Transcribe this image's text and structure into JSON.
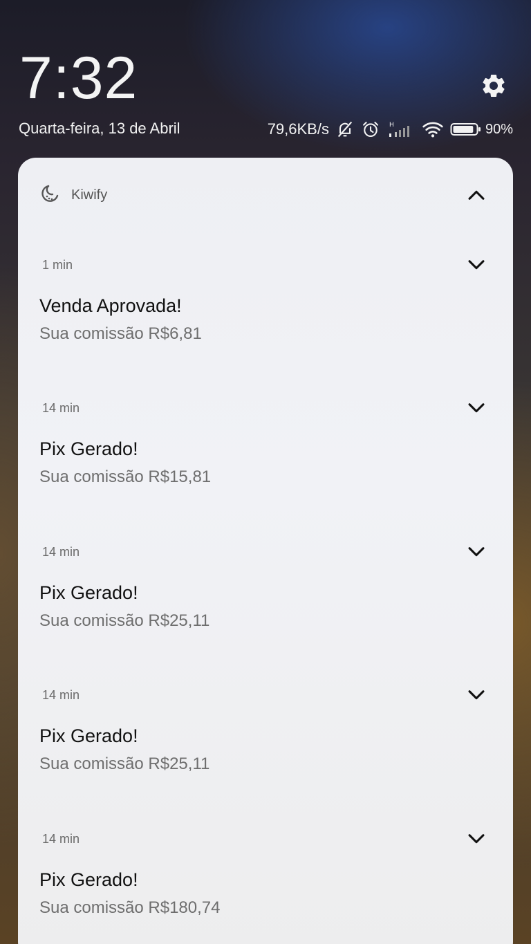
{
  "status_bar": {
    "time": "7:32",
    "date": "Quarta-feira, 13 de Abril",
    "net_speed": "79,6KB/s",
    "battery_percent": "90%",
    "battery_level": 0.9,
    "icons": [
      "mute-icon",
      "alarm-icon",
      "signal-icon",
      "wifi-icon",
      "battery-icon",
      "gear-icon"
    ]
  },
  "notification_group": {
    "app_name": "Kiwify",
    "app_icon": "kiwify-app-icon",
    "notifications": [
      {
        "time": "1 min",
        "title": "Venda Aprovada!",
        "body": "Sua comissão R$6,81"
      },
      {
        "time": "14 min",
        "title": "Pix Gerado!",
        "body": "Sua comissão R$15,81"
      },
      {
        "time": "14 min",
        "title": "Pix Gerado!",
        "body": "Sua comissão R$25,11"
      },
      {
        "time": "14 min",
        "title": "Pix Gerado!",
        "body": "Sua comissão R$25,11"
      },
      {
        "time": "14 min",
        "title": "Pix Gerado!",
        "body": "Sua comissão R$180,74"
      }
    ]
  },
  "colors": {
    "card_background": "#eeeff3",
    "title_text": "#111111",
    "body_text": "#6e6e6e",
    "status_text": "#f2f2f2"
  }
}
